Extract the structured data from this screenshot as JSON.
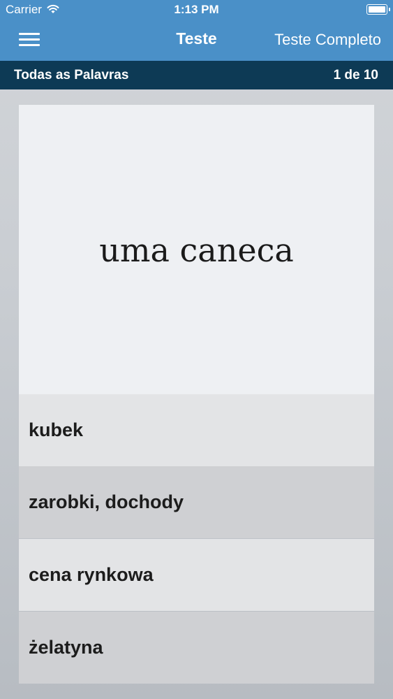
{
  "status_bar": {
    "carrier": "Carrier",
    "time": "1:13 PM",
    "wifi_icon": "wifi-icon",
    "battery_icon": "battery-icon"
  },
  "nav": {
    "menu_icon": "hamburger-menu-icon",
    "title": "Teste",
    "action": "Teste Completo"
  },
  "sub_header": {
    "category": "Todas as Palavras",
    "progress": "1 de 10"
  },
  "quiz": {
    "prompt": "uma caneca",
    "answers": [
      {
        "label": "kubek"
      },
      {
        "label": "zarobki, dochody"
      },
      {
        "label": "cena rynkowa"
      },
      {
        "label": "żelatyna"
      }
    ]
  },
  "colors": {
    "nav_blue": "#4a90c8",
    "sub_header_navy": "#0d3a55",
    "card_prompt_bg": "#eef0f3",
    "answer_light": "#e3e4e6",
    "answer_dark": "#cfd0d3"
  }
}
